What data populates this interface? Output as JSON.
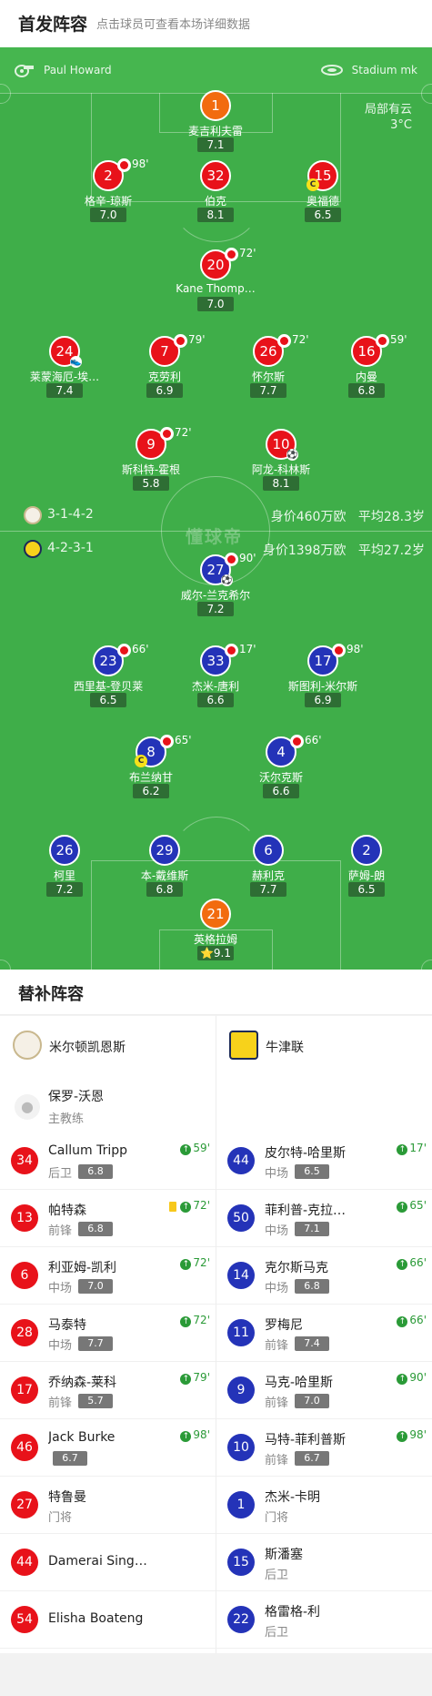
{
  "header": {
    "title": "首发阵容",
    "subtitle": "点击球员可查看本场详细数据"
  },
  "match_info": {
    "referee": "Paul Howard",
    "stadium": "Stadium mk",
    "weather": "局部有云",
    "temperature": "3°C"
  },
  "watermark": "懂球帝",
  "home_team": {
    "formation": "3-1-4-2",
    "value": "身价460万欧",
    "avg_age": "平均28.3岁",
    "name": "米尔顿凯恩斯",
    "color": "#e8121a"
  },
  "away_team": {
    "formation": "4-2-3-1",
    "value": "身价1398万欧",
    "avg_age": "平均27.2岁",
    "name": "牛津联",
    "color": "#2433b8"
  },
  "home_lineup": [
    {
      "num": "1",
      "name": "麦吉利夫雷",
      "rating": "7.1",
      "color": "orange"
    },
    {
      "num": "2",
      "name": "格辛-琼斯",
      "rating": "7.0",
      "sub": "98'"
    },
    {
      "num": "32",
      "name": "伯克",
      "rating": "8.1"
    },
    {
      "num": "15",
      "name": "奥福德",
      "rating": "6.5",
      "captain": "C"
    },
    {
      "num": "20",
      "name": "Kane Thomp…",
      "rating": "7.0",
      "sub": "72'"
    },
    {
      "num": "24",
      "name": "莱蒙海厄-埃…",
      "rating": "7.4",
      "assist": true
    },
    {
      "num": "7",
      "name": "克劳利",
      "rating": "6.9",
      "sub": "79'"
    },
    {
      "num": "26",
      "name": "怀尔斯",
      "rating": "7.7",
      "sub": "72'"
    },
    {
      "num": "16",
      "name": "内曼",
      "rating": "6.8",
      "sub": "59'"
    },
    {
      "num": "9",
      "name": "斯科特-霍根",
      "rating": "5.8",
      "sub": "72'"
    },
    {
      "num": "10",
      "name": "阿龙-科林斯",
      "rating": "8.1",
      "goal": true
    }
  ],
  "away_lineup": [
    {
      "num": "27",
      "name": "威尔-兰克希尔",
      "rating": "7.2",
      "sub": "90'",
      "goal": true
    },
    {
      "num": "23",
      "name": "西里基-登贝莱",
      "rating": "6.5",
      "sub": "66'"
    },
    {
      "num": "33",
      "name": "杰米-唐利",
      "rating": "6.6",
      "sub": "17'"
    },
    {
      "num": "17",
      "name": "斯图利-米尔斯",
      "rating": "6.9",
      "sub": "98'"
    },
    {
      "num": "8",
      "name": "布兰纳甘",
      "rating": "6.2",
      "sub": "65'",
      "captain": "C"
    },
    {
      "num": "4",
      "name": "沃尔克斯",
      "rating": "6.6",
      "sub": "66'"
    },
    {
      "num": "26",
      "name": "柯里",
      "rating": "7.2"
    },
    {
      "num": "29",
      "name": "本-戴维斯",
      "rating": "6.8"
    },
    {
      "num": "6",
      "name": "赫利克",
      "rating": "7.7"
    },
    {
      "num": "2",
      "name": "萨姆-朗",
      "rating": "6.5"
    },
    {
      "num": "21",
      "name": "英格拉姆",
      "rating": "⭐9.1",
      "color": "orange"
    }
  ],
  "subs": {
    "title": "替补阵容",
    "coach": {
      "name": "保罗-沃恩",
      "role": "主教练"
    },
    "home": [
      {
        "num": "34",
        "name": "Callum Tripp",
        "pos": "后卫",
        "rating": "6.8",
        "in": "59'"
      },
      {
        "num": "13",
        "name": "帕特森",
        "pos": "前锋",
        "rating": "6.8",
        "in": "72'",
        "yellow": true
      },
      {
        "num": "6",
        "name": "利亚姆-凯利",
        "pos": "中场",
        "rating": "7.0",
        "in": "72'"
      },
      {
        "num": "28",
        "name": "马泰特",
        "pos": "中场",
        "rating": "7.7",
        "in": "72'"
      },
      {
        "num": "17",
        "name": "乔纳森-莱科",
        "pos": "前锋",
        "rating": "5.7",
        "in": "79'"
      },
      {
        "num": "46",
        "name": "Jack Burke",
        "pos": "",
        "rating": "6.7",
        "in": "98'"
      },
      {
        "num": "27",
        "name": "特鲁曼",
        "pos": "门将",
        "rating": "",
        "in": ""
      },
      {
        "num": "44",
        "name": "Damerai Sing…",
        "pos": "",
        "rating": "",
        "in": ""
      },
      {
        "num": "54",
        "name": "Elisha Boateng",
        "pos": "",
        "rating": "",
        "in": ""
      }
    ],
    "away": [
      {
        "num": "44",
        "name": "皮尔特-哈里斯",
        "pos": "中场",
        "rating": "6.5",
        "in": "17'"
      },
      {
        "num": "50",
        "name": "菲利普-克拉…",
        "pos": "中场",
        "rating": "7.1",
        "in": "65'"
      },
      {
        "num": "14",
        "name": "克尔斯马克",
        "pos": "中场",
        "rating": "6.8",
        "in": "66'"
      },
      {
        "num": "11",
        "name": "罗梅尼",
        "pos": "前锋",
        "rating": "7.4",
        "in": "66'"
      },
      {
        "num": "9",
        "name": "马克-哈里斯",
        "pos": "前锋",
        "rating": "7.0",
        "in": "90'"
      },
      {
        "num": "10",
        "name": "马特-菲利普斯",
        "pos": "前锋",
        "rating": "6.7",
        "in": "98'"
      },
      {
        "num": "1",
        "name": "杰米-卡明",
        "pos": "门将",
        "rating": "",
        "in": ""
      },
      {
        "num": "15",
        "name": "斯潘塞",
        "pos": "后卫",
        "rating": "",
        "in": ""
      },
      {
        "num": "22",
        "name": "格雷格-利",
        "pos": "后卫",
        "rating": "",
        "in": ""
      }
    ]
  }
}
